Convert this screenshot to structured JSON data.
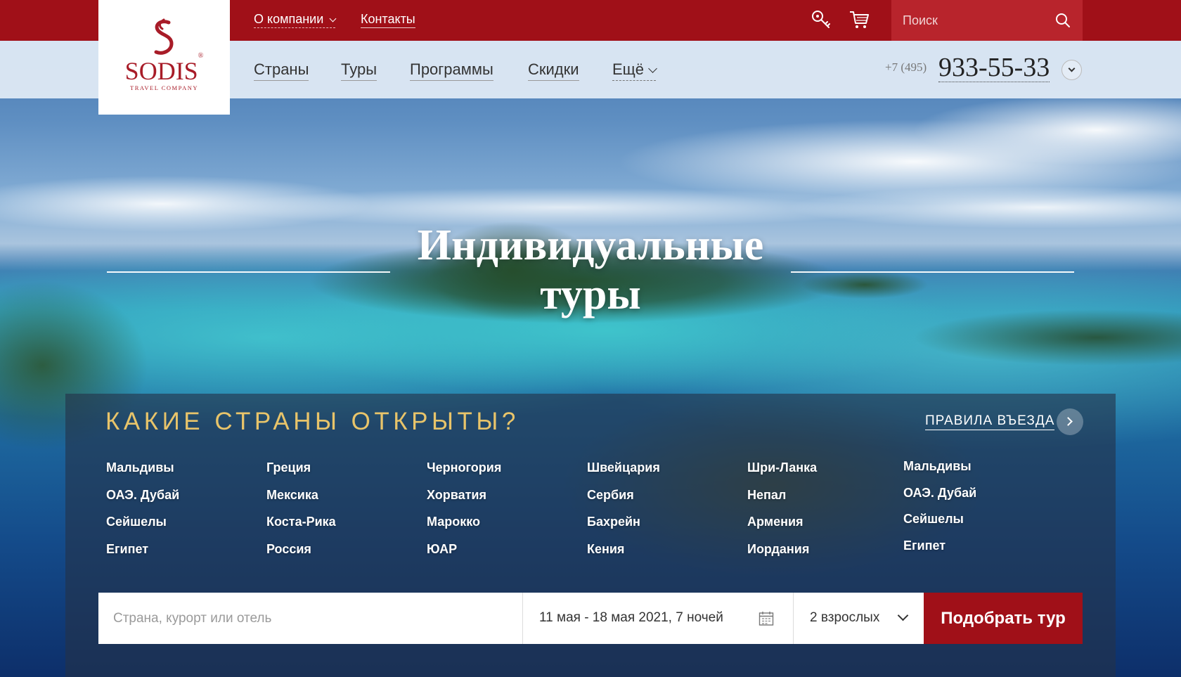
{
  "brand": {
    "name": "SODIS",
    "tagline": "TRAVEL COMPANY"
  },
  "topbar": {
    "about_label": "О компании",
    "contacts_label": "Контакты",
    "search_placeholder": "Поиск",
    "icons": [
      "key-icon",
      "cart-icon",
      "search-icon"
    ]
  },
  "nav": {
    "items": [
      "Страны",
      "Туры",
      "Программы",
      "Скидки"
    ],
    "more_label": "Ещё"
  },
  "phone": {
    "prefix": "+7 (495)",
    "number": "933-55-33"
  },
  "hero": {
    "title_line1": "Индивидуальные",
    "title_line2": "туры"
  },
  "open_countries": {
    "title": "КАКИЕ СТРАНЫ ОТКРЫТЫ?",
    "rules_label": "ПРАВИЛА ВЪЕЗДА",
    "columns": [
      [
        "Мальдивы",
        "ОАЭ. Дубай",
        "Сейшелы",
        "Египет"
      ],
      [
        "Греция",
        "Мексика",
        "Коста-Рика",
        "Россия"
      ],
      [
        "Черногория",
        "Хорватия",
        "Марокко",
        "ЮАР"
      ],
      [
        "Швейцария",
        "Сербия",
        "Бахрейн",
        "Кения"
      ],
      [
        "Шри-Ланка",
        "Непал",
        "Армения",
        "Иордания"
      ],
      [
        "Мальдивы",
        "ОАЭ. Дубай",
        "Сейшелы",
        "Египет"
      ]
    ]
  },
  "search_form": {
    "destination_placeholder": "Страна, курорт или отель",
    "dates": "11 мая - 18 мая 2021, 7 ночей",
    "guests": "2 взрослых",
    "submit_label": "Подобрать тур"
  },
  "colors": {
    "brand_red": "#a01018",
    "gold": "#e8c46a"
  }
}
